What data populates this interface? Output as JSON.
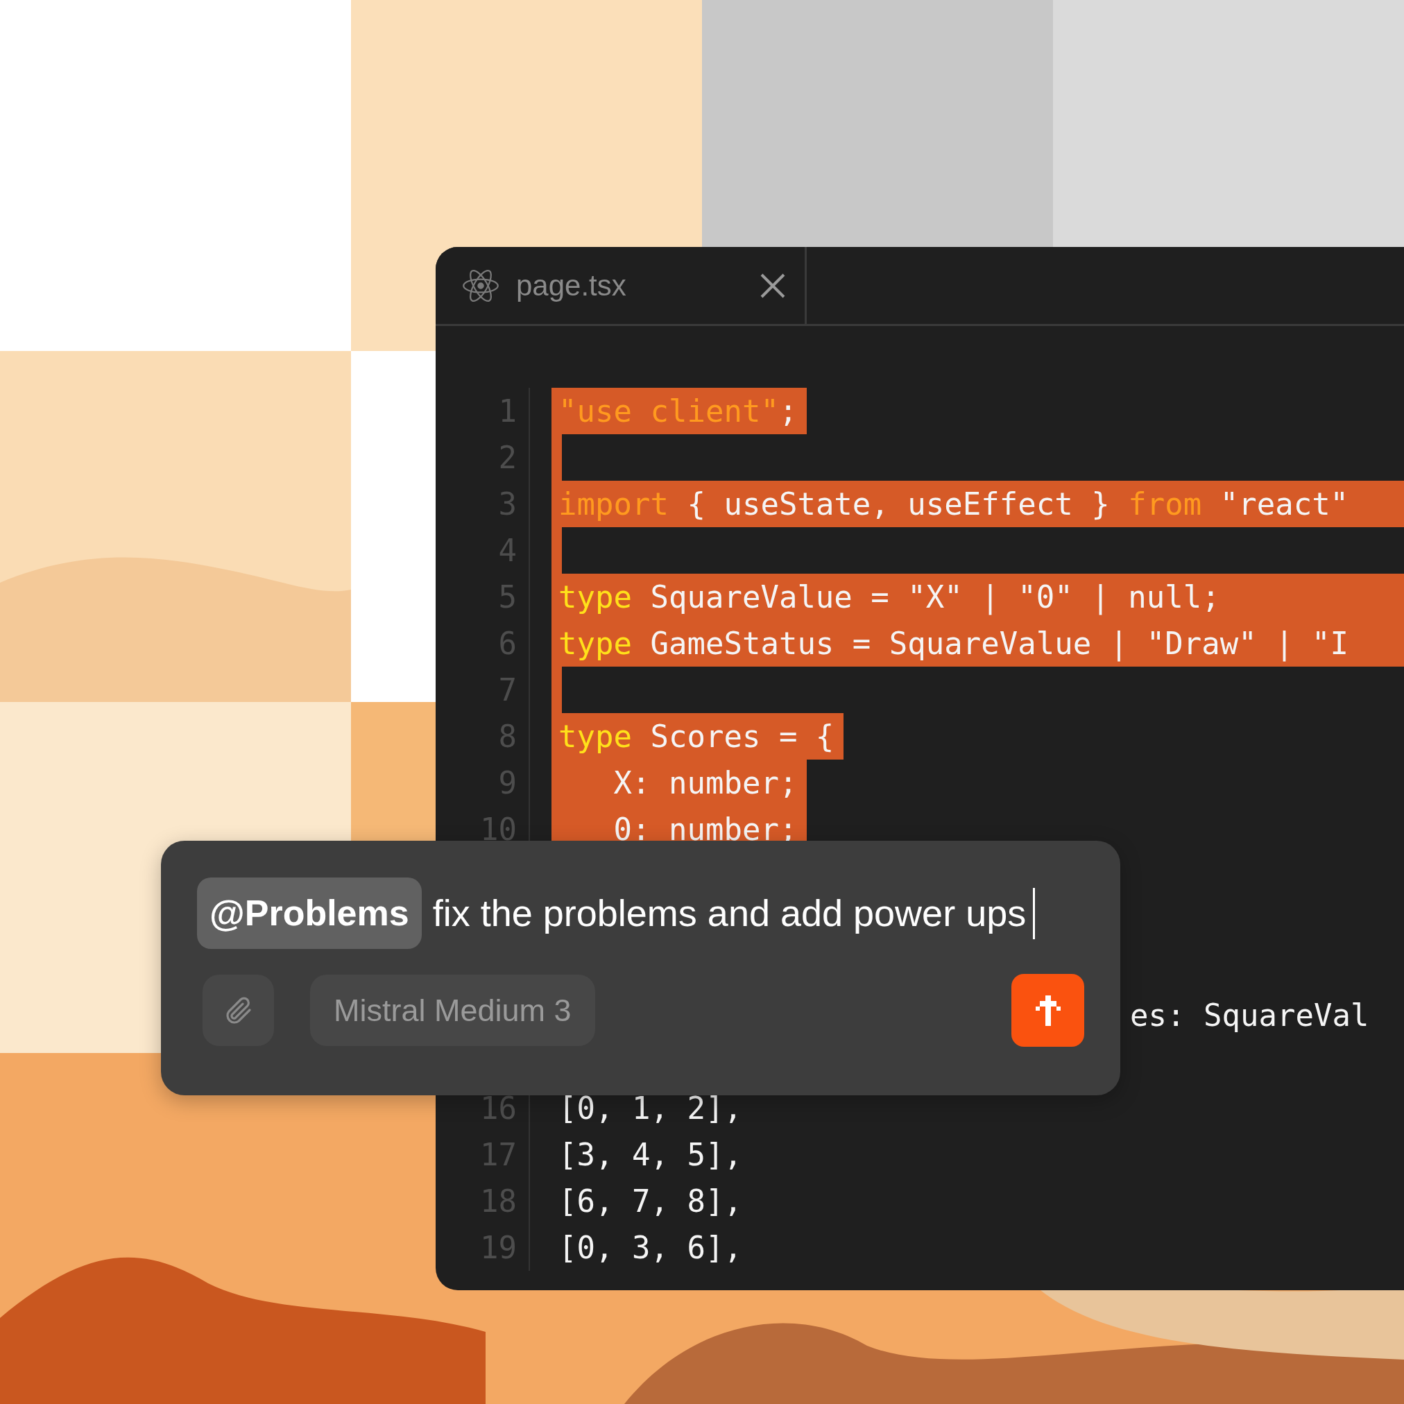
{
  "editor": {
    "tabs": [
      {
        "label": "page.tsx",
        "selected": true
      }
    ],
    "code_lines_top": [
      {
        "number": "1",
        "highlighted": true,
        "kind": "partial",
        "segments": [
          {
            "text": "\"use client\"",
            "color": "#ff9a1f"
          },
          {
            "text": ";",
            "color": "#f5f5f5"
          }
        ]
      },
      {
        "number": "2",
        "highlighted": true
      },
      {
        "number": "3",
        "highlighted": true,
        "kind": "full",
        "segments": [
          {
            "text": "import",
            "color": "#ff9a1f"
          },
          {
            "text": " { useState, useEffect } ",
            "color": "#f5f5f5"
          },
          {
            "text": "from",
            "color": "#ff9a1f"
          },
          {
            "text": " \"react\"",
            "color": "#f5f5f5"
          }
        ]
      },
      {
        "number": "4",
        "highlighted": true
      },
      {
        "number": "5",
        "highlighted": true,
        "kind": "full",
        "segments": [
          {
            "text": "type",
            "color": "#ffe11a"
          },
          {
            "text": " SquareValue = \"X\" | \"0\" | null;",
            "color": "#f5f5f5"
          }
        ]
      },
      {
        "number": "6",
        "highlighted": true,
        "kind": "full",
        "segments": [
          {
            "text": "type",
            "color": "#ffe11a"
          },
          {
            "text": " GameStatus = SquareValue | \"Draw\" | \"I",
            "color": "#f5f5f5"
          }
        ]
      },
      {
        "number": "7",
        "highlighted": true
      },
      {
        "number": "8",
        "highlighted": true,
        "kind": "partial",
        "segments": [
          {
            "text": "type",
            "color": "#ffe11a"
          },
          {
            "text": " Scores = {",
            "color": "#f5f5f5"
          }
        ]
      },
      {
        "number": "9",
        "highlighted": true,
        "kind": "partial",
        "segments": [
          {
            "text": "   X: number;",
            "color": "#f5f5f5"
          }
        ]
      },
      {
        "number": "10",
        "highlighted": true,
        "kind": "partial",
        "segments": [
          {
            "text": "   0: number;",
            "color": "#f5f5f5"
          }
        ]
      }
    ],
    "code_tail_line": {
      "text": "es: SquareVal"
    },
    "code_lines_bottom": [
      {
        "number": "16",
        "highlighted": false,
        "segments": [
          {
            "text": "[0, 1, 2],",
            "color": "#f5f5f5"
          }
        ]
      },
      {
        "number": "17",
        "highlighted": false,
        "segments": [
          {
            "text": "[3, 4, 5],",
            "color": "#f5f5f5"
          }
        ]
      },
      {
        "number": "18",
        "highlighted": false,
        "segments": [
          {
            "text": "[6, 7, 8],",
            "color": "#f5f5f5"
          }
        ]
      },
      {
        "number": "19",
        "highlighted": false,
        "segments": [
          {
            "text": "[0, 3, 6],",
            "color": "#f5f5f5"
          }
        ]
      }
    ]
  },
  "chat": {
    "mention": "@Problems",
    "message": "fix the problems and add power ups",
    "model": "Mistral Medium 3"
  }
}
